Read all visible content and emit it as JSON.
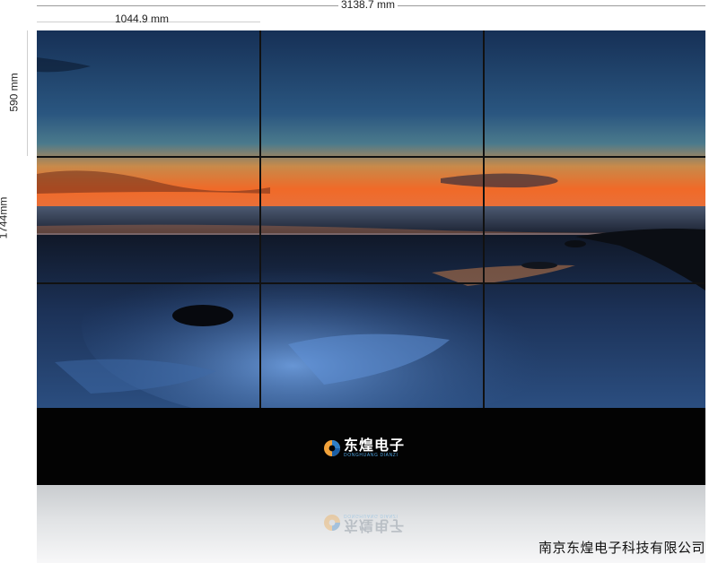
{
  "dimensions": {
    "total_width": "3138.7 mm",
    "unit_width": "1044.9 mm",
    "unit_height": "590 mm",
    "total_height": "1744mm"
  },
  "logo": {
    "chinese": "东煌电子",
    "pinyin": "DONGHUANG DIANZI"
  },
  "company": "南京东煌电子科技有限公司",
  "colors": {
    "cabinet": "#030303",
    "logo_accent": "#4fa3e0",
    "sky_top": "#1f3c66",
    "sunset": "#f07a2e"
  },
  "scene": "seaside-sunset-icon"
}
